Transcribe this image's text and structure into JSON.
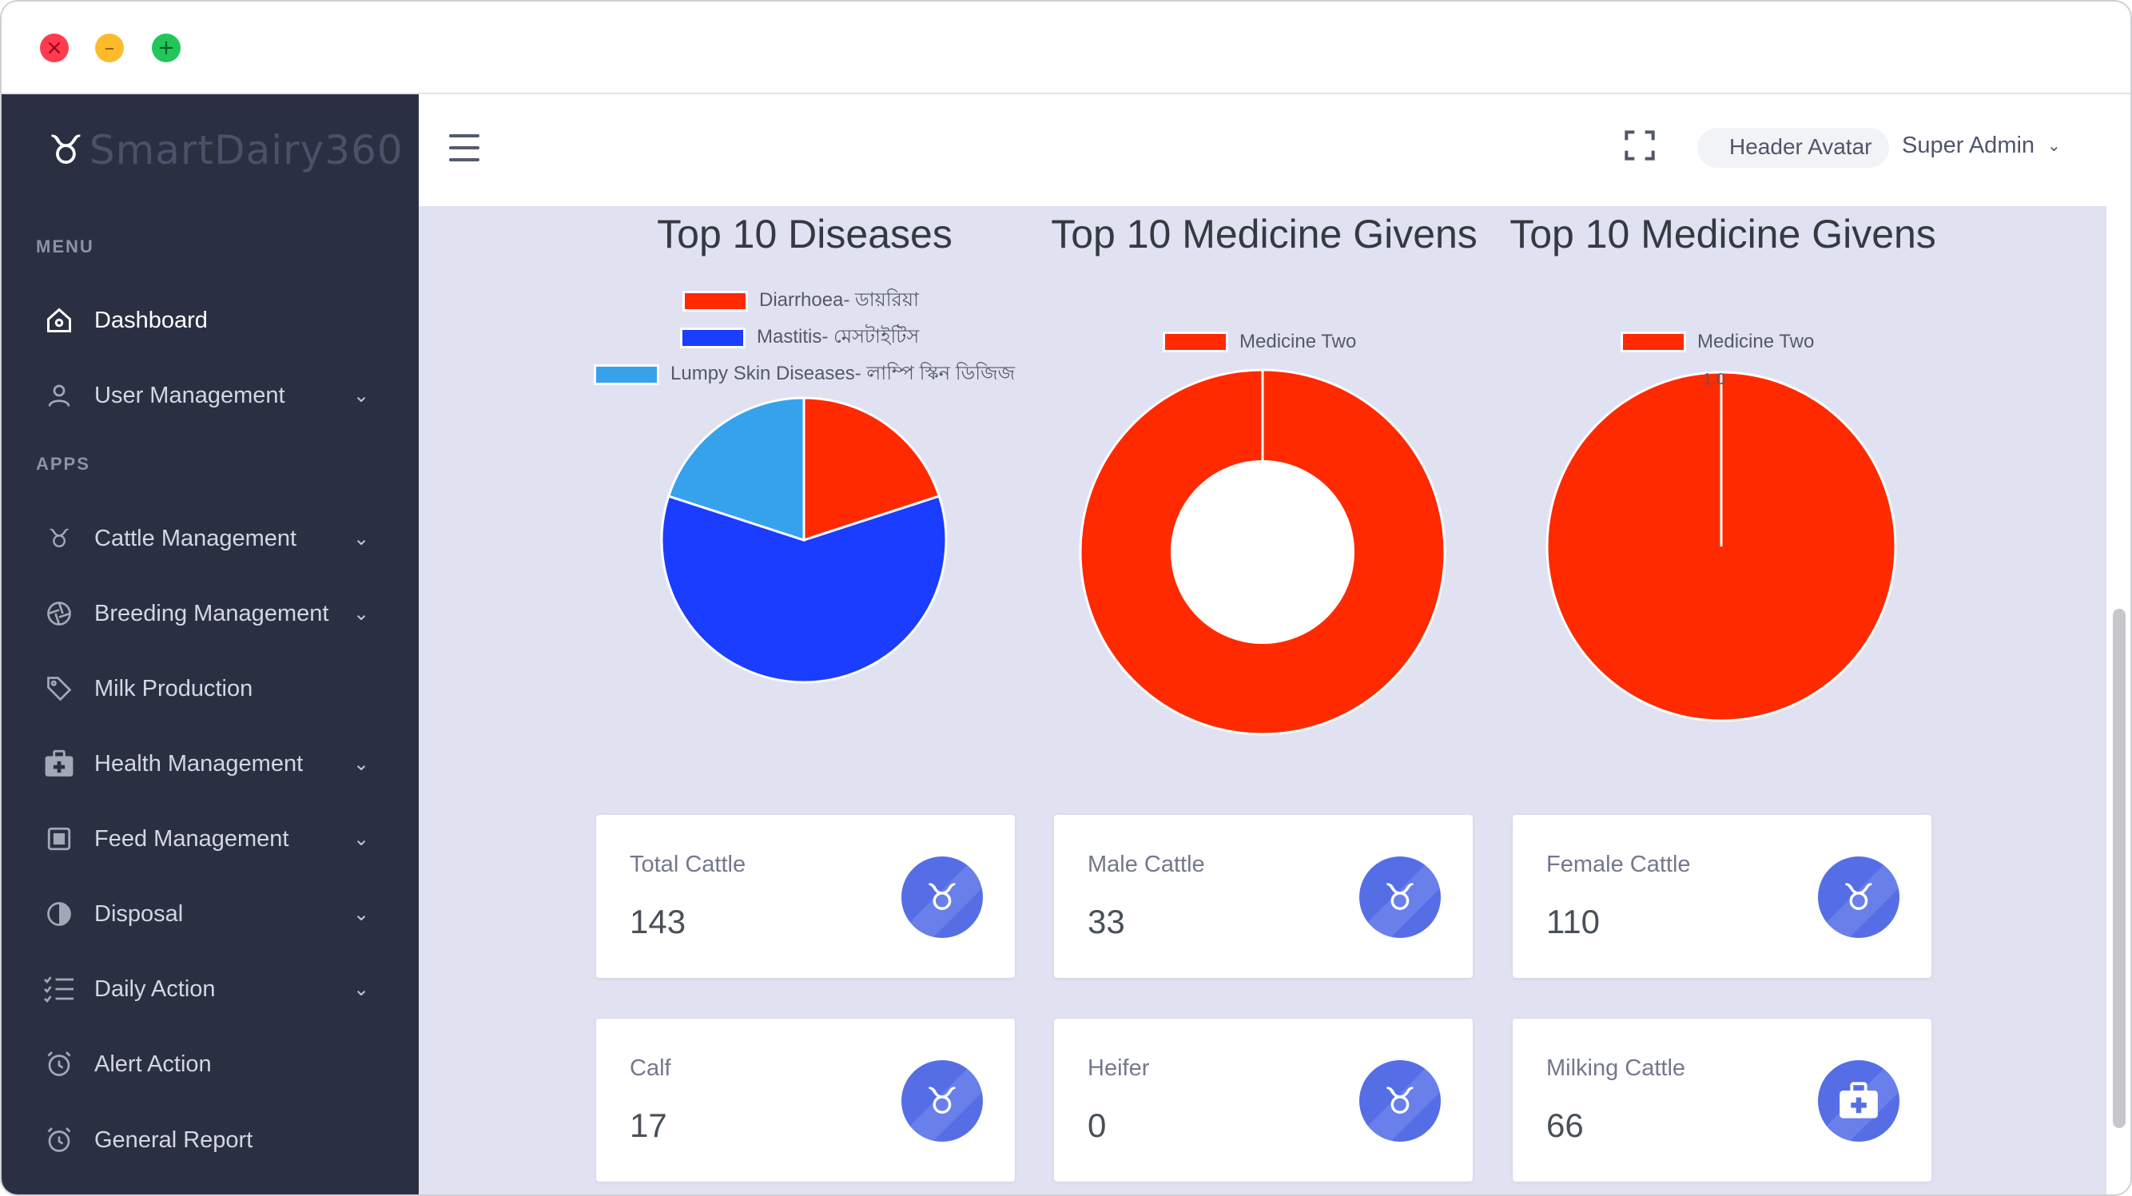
{
  "window": {
    "controls": {
      "close": "×",
      "minimize": "–",
      "maximize": "+"
    }
  },
  "sidebar": {
    "brand": "SmartDairy360",
    "brand_icon": "cow-icon",
    "sections": {
      "menu": "MENU",
      "apps": "APPS"
    },
    "items": [
      {
        "label": "Dashboard",
        "icon": "home-icon",
        "active": true,
        "has_submenu": false
      },
      {
        "label": "User Management",
        "icon": "user-icon",
        "active": false,
        "has_submenu": true
      },
      {
        "label": "Cattle Management",
        "icon": "cow-icon",
        "active": false,
        "has_submenu": true
      },
      {
        "label": "Breeding Management",
        "icon": "aperture-icon",
        "active": false,
        "has_submenu": true
      },
      {
        "label": "Milk Production",
        "icon": "tag-icon",
        "active": false,
        "has_submenu": false
      },
      {
        "label": "Health Management",
        "icon": "medkit-icon",
        "active": false,
        "has_submenu": true
      },
      {
        "label": "Feed Management",
        "icon": "feed-box-icon",
        "active": false,
        "has_submenu": true
      },
      {
        "label": "Disposal",
        "icon": "half-circle-icon",
        "active": false,
        "has_submenu": true
      },
      {
        "label": "Daily Action",
        "icon": "checklist-icon",
        "active": false,
        "has_submenu": true
      },
      {
        "label": "Alert Action",
        "icon": "alarm-clock-icon",
        "active": false,
        "has_submenu": false
      },
      {
        "label": "General Report",
        "icon": "alarm-clock-icon",
        "active": false,
        "has_submenu": false
      }
    ]
  },
  "header": {
    "menu_icon": "hamburger-icon",
    "fullscreen_icon": "fullscreen-icon",
    "avatar_alt": "Header Avatar",
    "user_name": "Super Admin",
    "caret": "⌄"
  },
  "charts_text": {
    "diseases_title": "Top 10 Diseases",
    "medicine_title_1": "Top 10 Medicine Givens",
    "medicine_title_2": "Top 10 Medicine Givens",
    "medicine_legend_1": "Medicine Two",
    "medicine_legend_2": "Medicine Two",
    "pie_top_label": "1.0"
  },
  "chart_data": [
    {
      "type": "pie",
      "title": "Top 10 Diseases",
      "legend_position": "top",
      "categories": [
        "Diarrhoea- ডায়রিয়া",
        "Mastitis- মেসটাইটিস",
        "Lumpy Skin Diseases- লাম্পি স্কিন ডিজিজ"
      ],
      "values": [
        1,
        3,
        1
      ],
      "colors": [
        "#ff2a00",
        "#1a3dff",
        "#36a2eb"
      ]
    },
    {
      "type": "pie",
      "variant": "doughnut",
      "title": "Top 10 Medicine Givens",
      "legend_position": "top",
      "categories": [
        "Medicine Two"
      ],
      "values": [
        1
      ],
      "colors": [
        "#ff2a00"
      ]
    },
    {
      "type": "pie",
      "title": "Top 10 Medicine Givens",
      "legend_position": "top",
      "categories": [
        "Medicine Two"
      ],
      "values": [
        1.0
      ],
      "colors": [
        "#ff2a00"
      ]
    }
  ],
  "cards": [
    {
      "label": "Total Cattle",
      "value": "143",
      "icon": "cow-icon"
    },
    {
      "label": "Male Cattle",
      "value": "33",
      "icon": "cow-icon"
    },
    {
      "label": "Female Cattle",
      "value": "110",
      "icon": "cow-icon"
    },
    {
      "label": "Calf",
      "value": "17",
      "icon": "cow-icon"
    },
    {
      "label": "Heifer",
      "value": "0",
      "icon": "cow-icon"
    },
    {
      "label": "Milking Cattle",
      "value": "66",
      "icon": "medkit-icon"
    }
  ],
  "colors": {
    "sidebar_bg": "#2a3042",
    "content_bg": "#e0e1f1",
    "accent": "#556ee6"
  }
}
